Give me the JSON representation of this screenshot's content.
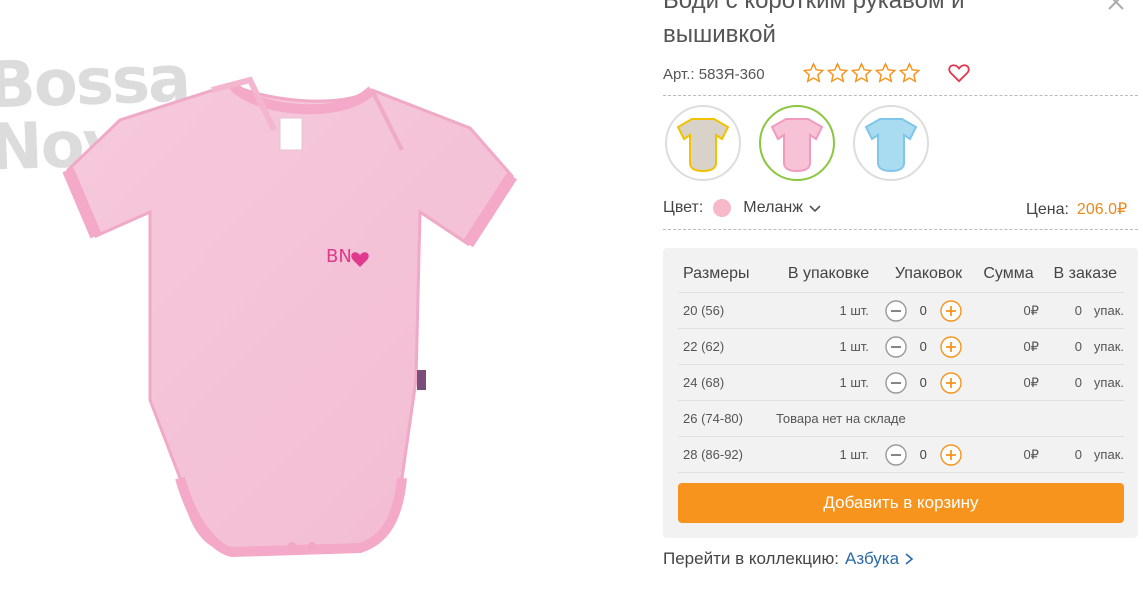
{
  "product": {
    "title": "Боди с коротким рукавом и вышивкой",
    "article_label": "Арт.:",
    "article_value": "583Я-360",
    "rating_stars": 5,
    "rating_filled": 0
  },
  "watermark": {
    "text": "Bossa Nova"
  },
  "embroidery": {
    "text": "BN"
  },
  "swatches": [
    {
      "name": "grey-yellow",
      "color": "#d8d2c8",
      "trim": "#f2c200"
    },
    {
      "name": "pink",
      "color": "#f7c2d6",
      "trim": "#f19ac0"
    },
    {
      "name": "blue",
      "color": "#a9dbf1",
      "trim": "#7fc6e8"
    }
  ],
  "color_selector": {
    "label": "Цвет:",
    "value": "Меланж",
    "dot_color": "#f7b8c9"
  },
  "price": {
    "label": "Цена:",
    "value": "206.0₽"
  },
  "order_table": {
    "headers": [
      "Размеры",
      "В упаковке",
      "Упаковок",
      "Сумма",
      "В заказе"
    ],
    "rows": [
      {
        "size": "20 (56)",
        "pack": "1 шт.",
        "qty": "0",
        "sum": "0₽",
        "ordered": "0",
        "unit": "упак."
      },
      {
        "size": "22 (62)",
        "pack": "1 шт.",
        "qty": "0",
        "sum": "0₽",
        "ordered": "0",
        "unit": "упак."
      },
      {
        "size": "24 (68)",
        "pack": "1 шт.",
        "qty": "0",
        "sum": "0₽",
        "ordered": "0",
        "unit": "упак."
      },
      {
        "size": "26 (74-80)",
        "out_of_stock": "Товара нет на складе"
      },
      {
        "size": "28 (86-92)",
        "pack": "1 шт.",
        "qty": "0",
        "sum": "0₽",
        "ordered": "0",
        "unit": "упак."
      }
    ]
  },
  "add_to_cart": {
    "label": "Добавить в корзину"
  },
  "collection": {
    "label": "Перейти в коллекцию:",
    "link": "Азбука"
  },
  "colors": {
    "accent": "#f7941d",
    "price": "#e9891e",
    "active_swatch": "#8cc63f",
    "link": "#2a6aa8",
    "heart": "#e2384f"
  }
}
